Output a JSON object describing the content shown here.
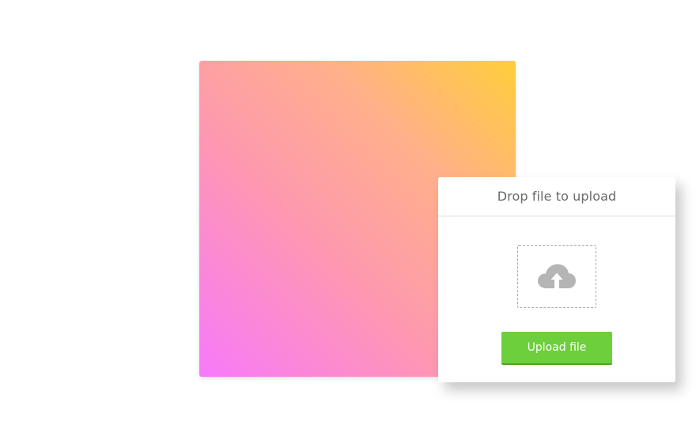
{
  "card": {
    "title": "Drop file to upload"
  },
  "dropzone": {
    "icon": "cloud-upload-icon"
  },
  "upload_button": {
    "label": "Upload file"
  },
  "colors": {
    "gradient_top_right": "#ffce3a",
    "gradient_bottom_left": "#f77afa",
    "button": "#6dcf3c",
    "button_border": "#4aa51f",
    "title_text": "#6a6a6a",
    "icon": "#b5b5b5"
  }
}
